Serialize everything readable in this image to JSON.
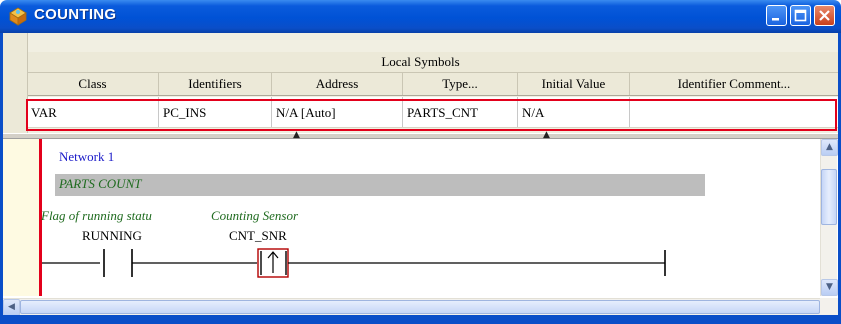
{
  "window": {
    "title": "COUNTING"
  },
  "symbols": {
    "section_title": "Local Symbols",
    "columns": [
      "Class",
      "Identifiers",
      "Address",
      "Type...",
      "Initial Value",
      "Identifier Comment..."
    ],
    "rows": [
      [
        "VAR",
        "PC_INS",
        "N/A [Auto]",
        "PARTS_CNT",
        "N/A",
        ""
      ]
    ]
  },
  "ladder": {
    "network_label": "Network 1",
    "network_comment": "PARTS COUNT",
    "contacts": [
      {
        "comment": "Flag of running statu",
        "name": "RUNNING",
        "type": "normally-open"
      },
      {
        "comment": "Counting Sensor",
        "name": "CNT_SNR",
        "type": "rising-edge"
      }
    ]
  },
  "colors": {
    "title_bar": "#0052d6",
    "selection_outline": "#e3001b",
    "left_rail": "#e3001b",
    "network_label": "#1a1ac8",
    "comment_text": "#1f6b1f"
  }
}
